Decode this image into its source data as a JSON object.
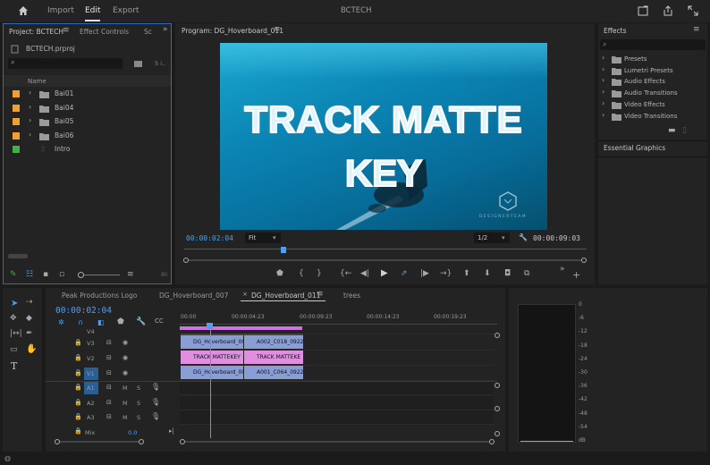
{
  "header": {
    "nav": [
      "Import",
      "Edit",
      "Export"
    ],
    "title": "BCTECH"
  },
  "project": {
    "tabs": [
      "Project: BCTECH",
      "Effect Controls",
      "Sc"
    ],
    "file": "BCTECH.prproj",
    "items_count": "5 i..",
    "name_col": "Name",
    "items": [
      {
        "name": "Bai01",
        "color": "#f0a030"
      },
      {
        "name": "Bai04",
        "color": "#f0a030"
      },
      {
        "name": "Bai05",
        "color": "#f0a030"
      },
      {
        "name": "Bai06",
        "color": "#f0a030"
      },
      {
        "name": "Intro",
        "color": "#3fb14a"
      }
    ],
    "zoom_value": "8li"
  },
  "program": {
    "title": "Program: DG_Hoverboard_011",
    "video_title_1": "TRACK MATTE",
    "video_title_2": "KEY",
    "watermark": "D E S I G N E R   T E A M",
    "timecode": "00:00:02:04",
    "fit": "Fit",
    "resolution": "1/2",
    "duration": "00:00:09:03"
  },
  "effects": {
    "title": "Effects",
    "items": [
      "Presets",
      "Lumetri Presets",
      "Audio Effects",
      "Audio Transitions",
      "Video Effects",
      "Video Transitions"
    ],
    "essential": "Essential Graphics"
  },
  "timeline": {
    "tabs": [
      "Peak Productions Logo",
      "DG_Hoverboard_007",
      "DG_Hoverboard_011",
      "trees"
    ],
    "active_tab_index": 2,
    "timecode": "00:00:02:04",
    "ruler": [
      "00:00",
      "00:00:04:23",
      "00:00:09:23",
      "00:00:14:23",
      "00:00:19:23"
    ],
    "video_tracks": [
      "V4",
      "V3",
      "V2",
      "V1"
    ],
    "audio_tracks": [
      "A1",
      "A2",
      "A3"
    ],
    "mix_label": "Mix",
    "mix_value": "0.0",
    "clips": {
      "v3a": "DG_Hoverboard_00",
      "v3b": "A002_C018_0922",
      "v2a": "TRACK MATTEKEY",
      "v2b": "TRACK MATTEKE",
      "v1a": "DG_Hoverboard_00",
      "v1b": "A001_C064_0922"
    }
  },
  "meter": {
    "scale": [
      "0",
      "-6",
      "-12",
      "-18",
      "-24",
      "-30",
      "-36",
      "-42",
      "-48",
      "-54"
    ],
    "unit": "dB"
  }
}
